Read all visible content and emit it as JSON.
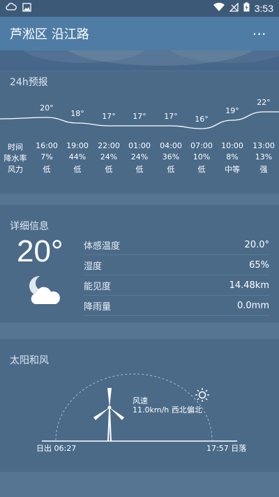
{
  "status_bar": {
    "time": "3:53",
    "icons": [
      "cloud-icon",
      "image-icon",
      "wifi-icon",
      "signal-icon",
      "battery-icon"
    ]
  },
  "app_bar": {
    "title": "芦淞区 沿江路",
    "more_label": "⋯"
  },
  "forecast": {
    "title": "24h预报",
    "temps": [
      "20°",
      "18°",
      "17°",
      "17°",
      "17°",
      "16°",
      "19°",
      "22°"
    ],
    "temp_values": [
      20,
      18,
      17,
      17,
      17,
      16,
      19,
      22
    ],
    "row_labels": {
      "time": "时间",
      "precip": "降水率",
      "wind": "风力"
    },
    "times": [
      "16:00",
      "19:00",
      "22:00",
      "01:00",
      "04:00",
      "07:00",
      "10:00",
      "13:00"
    ],
    "precip": [
      "7%",
      "44%",
      "24%",
      "24%",
      "36%",
      "10%",
      "8%",
      "13%"
    ],
    "wind": [
      "低",
      "低",
      "低",
      "低",
      "低",
      "低",
      "中等",
      "强"
    ]
  },
  "details": {
    "title": "详细信息",
    "temperature": "20°",
    "icon": "cloudy-moon-icon",
    "rows": [
      {
        "label": "体感温度",
        "value": "20.0°"
      },
      {
        "label": "湿度",
        "value": "65%"
      },
      {
        "label": "能见度",
        "value": "14.48km"
      },
      {
        "label": "降雨量",
        "value": "0.0mm"
      }
    ]
  },
  "sun_wind": {
    "title": "太阳和风",
    "wind_label": "风速",
    "wind_value": "11.0km/h 西北偏北",
    "sunrise": "日出 06:27",
    "sunset": "17:57 日落"
  },
  "colors": {
    "background": "#4a6a88",
    "app_bar": "#4f7ca4",
    "status_bar": "#3c5a78"
  }
}
